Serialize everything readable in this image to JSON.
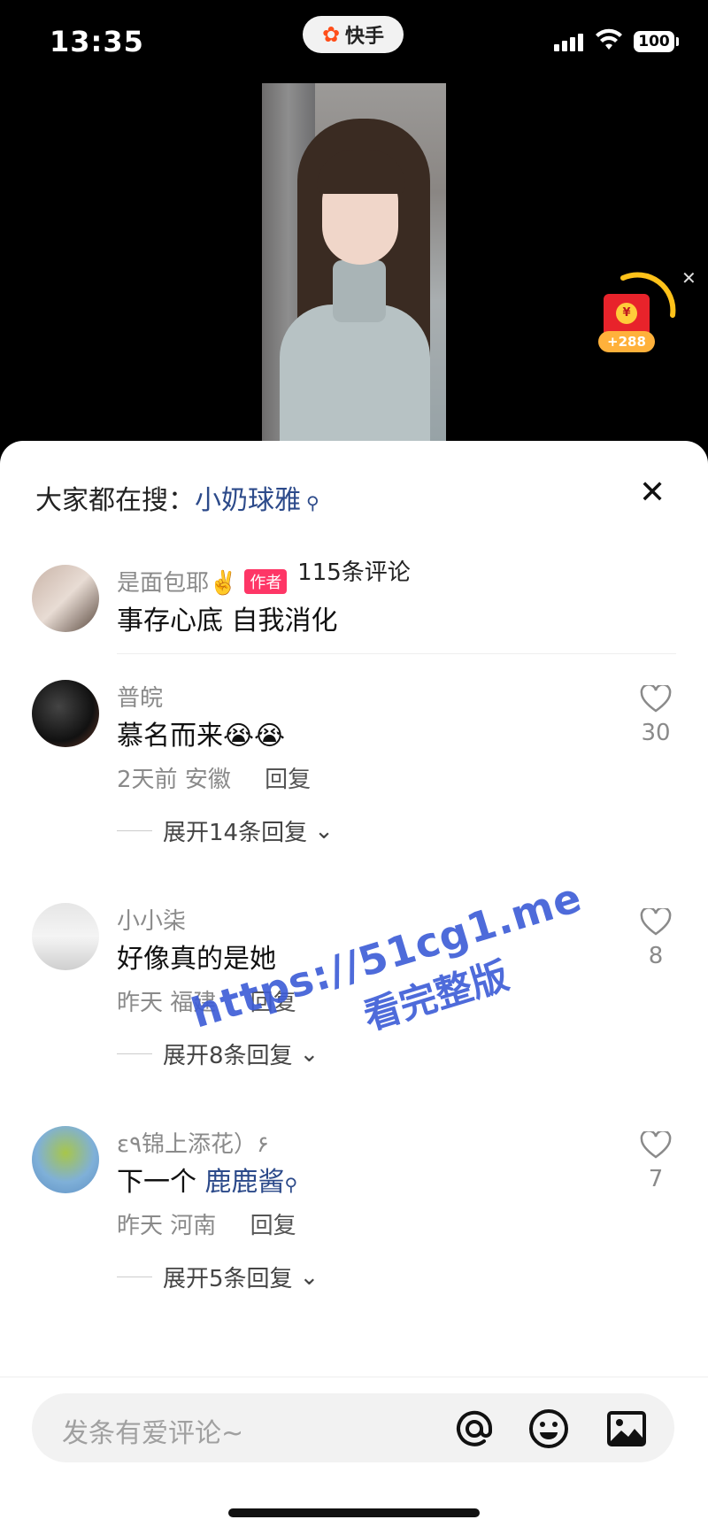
{
  "status": {
    "time": "13:35",
    "battery": "100"
  },
  "app": {
    "name": "快手"
  },
  "red_packet": {
    "amount": "+288",
    "coin_glyph": "¥"
  },
  "sheet": {
    "hot_search_label": "大家都在搜：",
    "hot_search_keyword": "小奶球雅",
    "comment_count": "115条评论",
    "close_glyph": "✕"
  },
  "comments": [
    {
      "user": "是面包耶✌️",
      "badge": "作者",
      "text": "事存心底 自我消化"
    },
    {
      "user": "普皖",
      "text": "慕名而来😭😭",
      "time": "2天前",
      "location": "安徽",
      "reply": "回复",
      "likes": "30",
      "expand": "展开14条回复"
    },
    {
      "user": "小小柒",
      "text": "好像真的是她",
      "time": "昨天",
      "location": "福建",
      "reply": "回复",
      "likes": "8",
      "expand": "展开8条回复"
    },
    {
      "user": "ε٩锦上添花）۶",
      "text_prefix": "下一个 ",
      "text_link": "鹿鹿酱",
      "time": "昨天",
      "location": "河南",
      "reply": "回复",
      "likes": "7",
      "expand": "展开5条回复"
    }
  ],
  "composer": {
    "placeholder": "发条有爱评论~"
  },
  "watermark": {
    "url": "https://51cg1.me",
    "text": "看完整版"
  },
  "colors": {
    "accent_link": "#2c4a8a",
    "author_badge": "#fe3666",
    "watermark": "#3b5bd6"
  }
}
